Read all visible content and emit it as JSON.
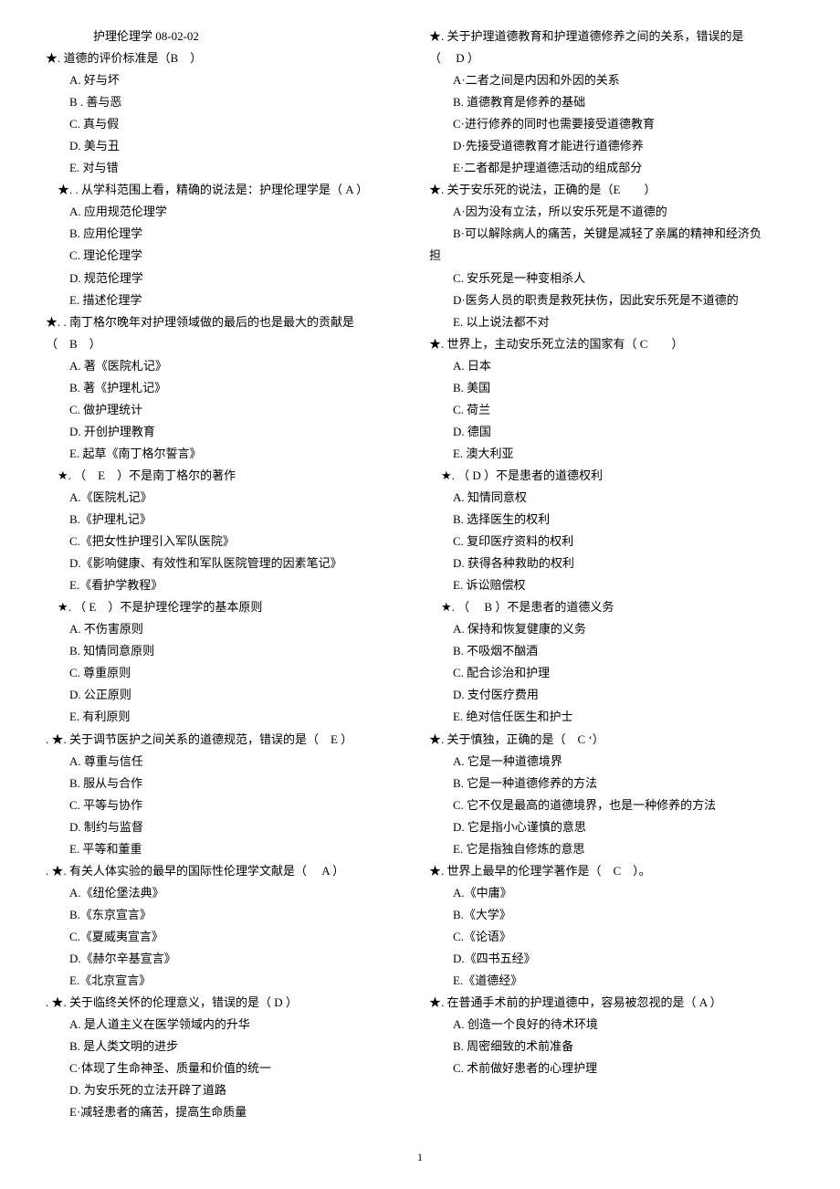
{
  "title": "护理伦理学 08-02-02",
  "footer": "1",
  "questions": [
    {
      "stem": "★. 道德的评价标准是（",
      "ans": "B",
      "tail": "　）",
      "opts": [
        "A.  好与坏",
        "B  . 善与恶",
        "C.  真与假",
        "D.  美与丑",
        "E.  对与错"
      ]
    },
    {
      "stem": "★. . 从学科范围上看，精确的说法是：护理伦理学是（",
      "ans": " A ",
      "tail": "）",
      "opts": [
        "A.  应用规范伦理学",
        "B.  应用伦理学",
        "C.  理论伦理学",
        "D.  规范伦理学",
        "E.  描述伦理学"
      ],
      "indented": true
    },
    {
      "stem": "★. . 南丁格尔晚年对护理领域做的最后的也是最大的贡献是",
      "stem2": "（　B　）",
      "opts": [
        "A.  著《医院札记》",
        "B.  著《护理札记》",
        "C.  做护理统计",
        "D.  开创护理教育",
        "E.  起草《南丁格尔誓言》"
      ]
    },
    {
      "stem": "★. （　E　）不是南丁格尔的著作",
      "opts": [
        "A.《医院札记》",
        "B.《护理札记》",
        "C.《把女性护理引入军队医院》",
        "D.《影响健康、有效性和军队医院管理的因素笔记》",
        "E.《看护学教程》"
      ],
      "indented": true
    },
    {
      "stem": "★. （ E　）不是护理伦理学的基本原则",
      "opts": [
        "A.  不伤害原则",
        "B.  知情同意原则",
        "C.  尊重原则",
        "D.  公正原则",
        "E.  有利原则"
      ],
      "indented": true
    },
    {
      "stem": ". ★. 关于调节医护之间关系的道德规范，错误的是（　E ）",
      "opts": [
        "A.  尊重与信任",
        "B.  服从与合作",
        "C.  平等与协作",
        "D.  制约与监督",
        "E.  平等和董重"
      ]
    },
    {
      "stem": ". ★. 有关人体实验的最早的国际性伦理学文献是（　 A ）",
      "opts": [
        "A.《纽伦堡法典》",
        "B.《东京宣言》",
        "C.《夏威夷宣言》",
        "D.《赫尔辛基宣言》",
        "E.《北京宣言》"
      ]
    },
    {
      "stem": ". ★. 关于临终关怀的伦理意义，错误的是（  D  ）",
      "opts": [
        "A.  是人道主义在医学领域内的升华",
        "B.  是人类文明的进步",
        "C·体现了生命神圣、质量和价值的统一",
        "D.  为安乐死的立法开辟了道路",
        "E·减轻患者的痛苦，提高生命质量"
      ]
    },
    {
      "stem": "★. 关于护理道德教育和护理道德修养之间的关系，错误的是",
      "stem2": "（　 D  ）",
      "opts": [
        "A·二者之间是内因和外因的关系",
        "B.  道德教育是修养的基础",
        "C·进行修养的同时也需要接受道德教育",
        "D·先接受道德教育才能进行道德修养",
        "E·二者都是护理道德活动的组成部分"
      ]
    },
    {
      "stem": "★. 关于安乐死的说法，正确的是（E　　）",
      "opts": [
        "A·因为没有立法，所以安乐死是不道德的"
      ],
      "multiline_opt": {
        "l1": "　　B·可以解除病人的痛苦，关键是减轻了亲属的精神和经济负",
        "l2": "担"
      },
      "opts2": [
        "C.  安乐死是一种变相杀人",
        "D·医务人员的职责是救死扶伤，因此安乐死是不道德的",
        "E.  以上说法都不对"
      ]
    },
    {
      "stem": "★. 世界上，主动安乐死立法的国家有（ C　　）",
      "opts": [
        "A.  日本",
        "B.  美国",
        "C.  荷兰",
        "D.  德国",
        "E.  澳大利亚"
      ]
    },
    {
      "stem": "★. （   D   ）不是患者的道德权利",
      "opts": [
        "A.  知情同意权",
        "B.  选择医生的权利",
        "C.  复印医疗资料的权利",
        "D.  获得各种救助的权利",
        "E.  诉讼赔偿权"
      ],
      "indented": true
    },
    {
      "stem": "★. （　 B  ）不是患者的道德义务",
      "opts": [
        "A.  保持和恢复健康的义务",
        "B.  不吸烟不酗酒",
        "C.  配合诊治和护理",
        "D.  支付医疗费用",
        "E.  绝对信任医生和护士"
      ],
      "indented": true
    },
    {
      "stem": "★. 关于慎独，正确的是（　C ‘）",
      "opts": [
        "A.  它是一种道德境界",
        "B.  它是一种道德修养的方法",
        "C.  它不仅是最高的道德境界，也是一种修养的方法",
        "D.  它是指小心谨慎的意思",
        "E.  它是指独自修炼的意思"
      ]
    },
    {
      "stem": "★. 世界上最早的伦理学著作是（　C　）。",
      "opts": [
        "A.《中庸》",
        "B.《大学》",
        "C.《论语》",
        "D.《四书五经》",
        "E.《道德经》"
      ]
    },
    {
      "stem": "★. 在普通手术前的护理道德中，容易被忽视的是（  A  ）",
      "opts": [
        "A.  创造一个良好的待术环境",
        "B.  周密细致的术前准备",
        "C.  术前做好患者的心理护理"
      ]
    }
  ]
}
